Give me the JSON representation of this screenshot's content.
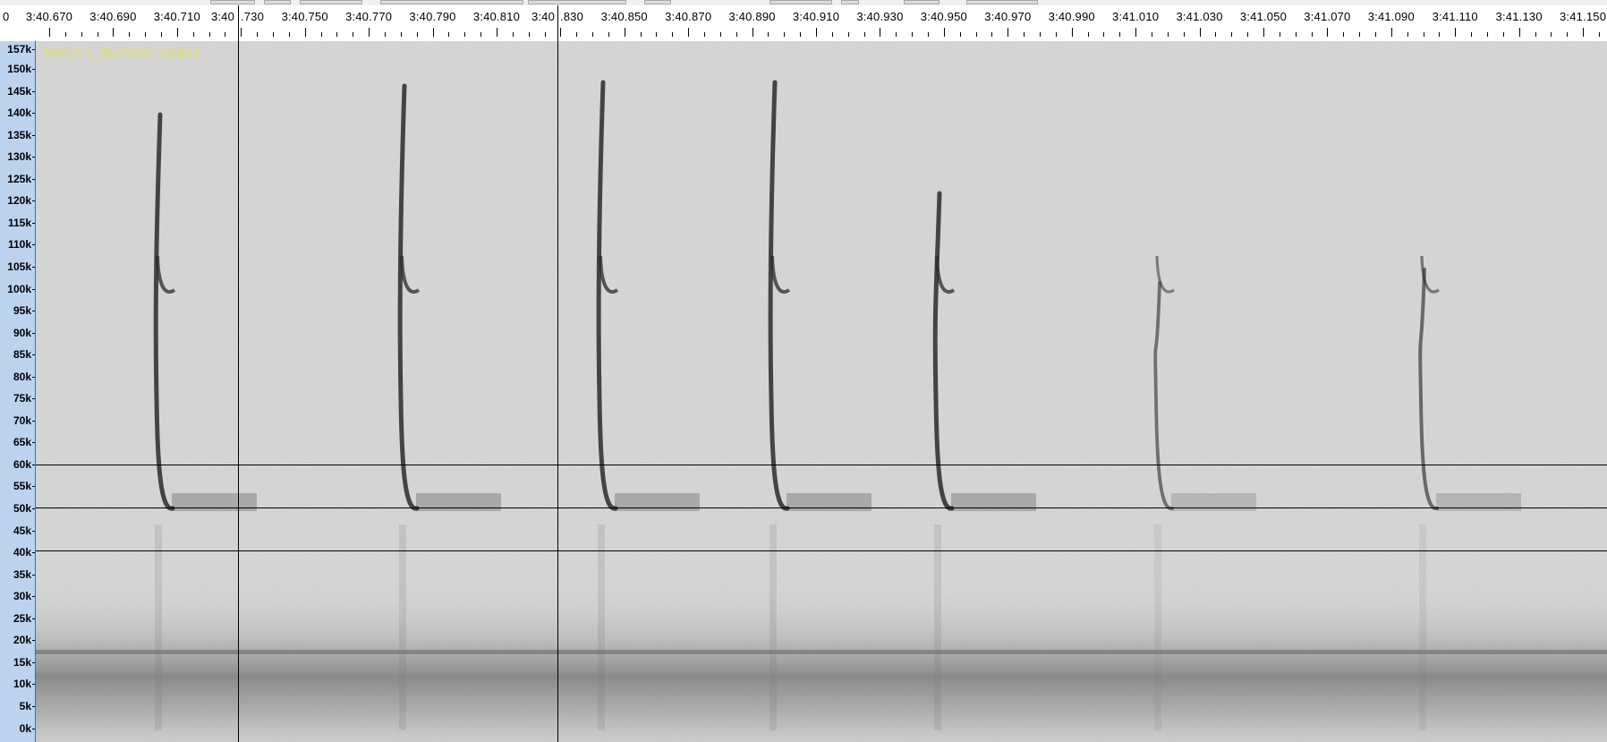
{
  "toolbar": {},
  "time_ruler": {
    "labels": [
      "3:40.670",
      "3:40.690",
      "3:40.710",
      "3:40.730",
      "3:40.750",
      "3:40.770",
      "3:40.790",
      "3:40.810",
      "3:40.830",
      "3:40.850",
      "3:40.870",
      "3:40.890",
      "3:40.910",
      "3:40.930",
      "3:40.950",
      "3:40.970",
      "3:40.990",
      "3:41.010",
      "3:41.030",
      "3:41.050",
      "3:41.070",
      "3:41.090",
      "3:41.110",
      "3:41.130",
      "3:41.150"
    ],
    "cut_first_label": "0",
    "cut_split_left_a": "3:40",
    "cut_split_right_a": ".730",
    "cut_split_left_b": "3:40",
    "cut_split_right_b": ".830"
  },
  "freq_axis": {
    "labels": [
      "157k",
      "150k",
      "145k",
      "140k",
      "135k",
      "130k",
      "125k",
      "120k",
      "115k",
      "110k",
      "105k",
      "100k",
      "95k",
      "90k",
      "85k",
      "80k",
      "75k",
      "70k",
      "65k",
      "60k",
      "55k",
      "50k",
      "45k",
      "40k",
      "35k",
      "30k",
      "25k",
      "20k",
      "15k",
      "10k",
      "5k",
      "0k"
    ]
  },
  "spectrogram": {
    "file_label": "PAR17-1_20170707_220014",
    "background_color": "#d7d7d7",
    "call_color": "#2a2a2a",
    "label_color": "#e6e24a"
  }
}
